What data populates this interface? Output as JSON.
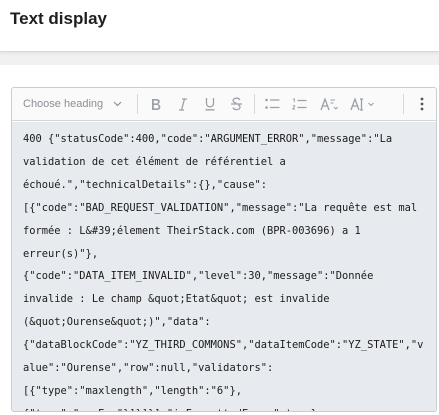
{
  "header": {
    "title": "Text display"
  },
  "toolbar": {
    "heading_placeholder": "Choose heading",
    "icons": [
      "bold-icon",
      "italic-icon",
      "underline-icon",
      "strikethrough-icon",
      "bulleted-list-icon",
      "numbered-list-icon",
      "font-size-icon",
      "text-style-icon",
      "more-options-icon"
    ]
  },
  "content": {
    "lines": [
      "400 {\"statusCode\":400,\"code\":\"ARGUMENT_ERROR\",\"message\":\"La",
      "validation de cet élément de référentiel a",
      "échoué.\",\"technicalDetails\":{},\"cause\":",
      "[{\"code\":\"BAD_REQUEST_VALIDATION\",\"message\":\"La requête est mal",
      "formée : L&#39;élement TheirStack.com (BPR-003696) a 1",
      "erreur(s)\"},",
      "{\"code\":\"DATA_ITEM_INVALID\",\"level\":30,\"message\":\"Donnée",
      "invalide : Le champ &quot;Etat&quot; est invalide",
      "(&quot;Ourense&quot;)\",\"data\":",
      "{\"dataBlockCode\":\"YZ_THIRD_COMMONS\",\"dataItemCode\":\"YZ_STATE\",\"v",
      "alue\":\"Ourense\",\"row\":null,\"validators\":",
      "[{\"type\":\"maxlength\",\"length\":\"6\"},",
      "{\"type\":\"regExp\"}]}]}],\"isFormattedError\":true}"
    ]
  }
}
